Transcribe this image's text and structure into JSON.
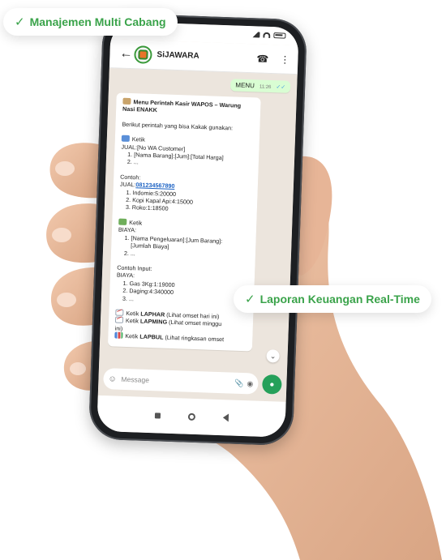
{
  "badges": {
    "top": "Manajemen Multi Cabang",
    "middle": "Laporan Keuangan Real-Time"
  },
  "appbar": {
    "contact_name": "SiJAWARA"
  },
  "chat": {
    "outgoing": {
      "text": "MENU",
      "time": "11:26"
    },
    "incoming": {
      "title": "Menu Perintah Kasir WAPOS – Warung",
      "title_cont": "Nasi ENAKK",
      "intro": "Berikut perintah yang bisa Kakak gunakan:",
      "jual": {
        "heading": "Ketik",
        "format": "JUAL:[No WA Customer]",
        "items": [
          "1. [Nama Barang]:[Jum]:[Total Harga]",
          "2. ..."
        ]
      },
      "jual_example": {
        "heading": "Contoh:",
        "prefix": "JUAL:",
        "phone": "081234567890",
        "items": [
          "1. Indomie:5:20000",
          "2. Kopi Kapal Api:4:15000",
          "3. Roko:1:18500"
        ]
      },
      "biaya": {
        "heading": "Ketik",
        "format": "BIAYA:",
        "item1": "1. [Nama Pengeluaran]:[Jum Barang]:",
        "item1_cont": "[Jumlah Biaya]",
        "item2": "2. ..."
      },
      "biaya_example": {
        "heading": "Contoh Input:",
        "format": "BIAYA:",
        "items": [
          "1. Gas 3Kg:1:19000",
          "2. Daging:4:340000",
          "3. ..."
        ]
      },
      "reports": [
        {
          "prefix": "Ketik",
          "cmd": "LAPHAR",
          "desc": "(Lihat omset hari ini)"
        },
        {
          "prefix": "Ketik",
          "cmd": "LAPMING",
          "desc": "(Lihat omset minggu",
          "desc_cont": "ini)"
        },
        {
          "prefix": "Ketik",
          "cmd": "LAPBUL",
          "desc": "(Lihat ringkasan omset"
        }
      ]
    },
    "scroll_icon": "chevron-double-down-icon"
  },
  "composer": {
    "placeholder": "Message"
  },
  "colors": {
    "badge_green": "#3aa34a",
    "outgoing_bubble": "#d9fdd3",
    "chat_background": "#ece5dd",
    "send_button": "#25a05a",
    "link": "#1d63c4"
  }
}
